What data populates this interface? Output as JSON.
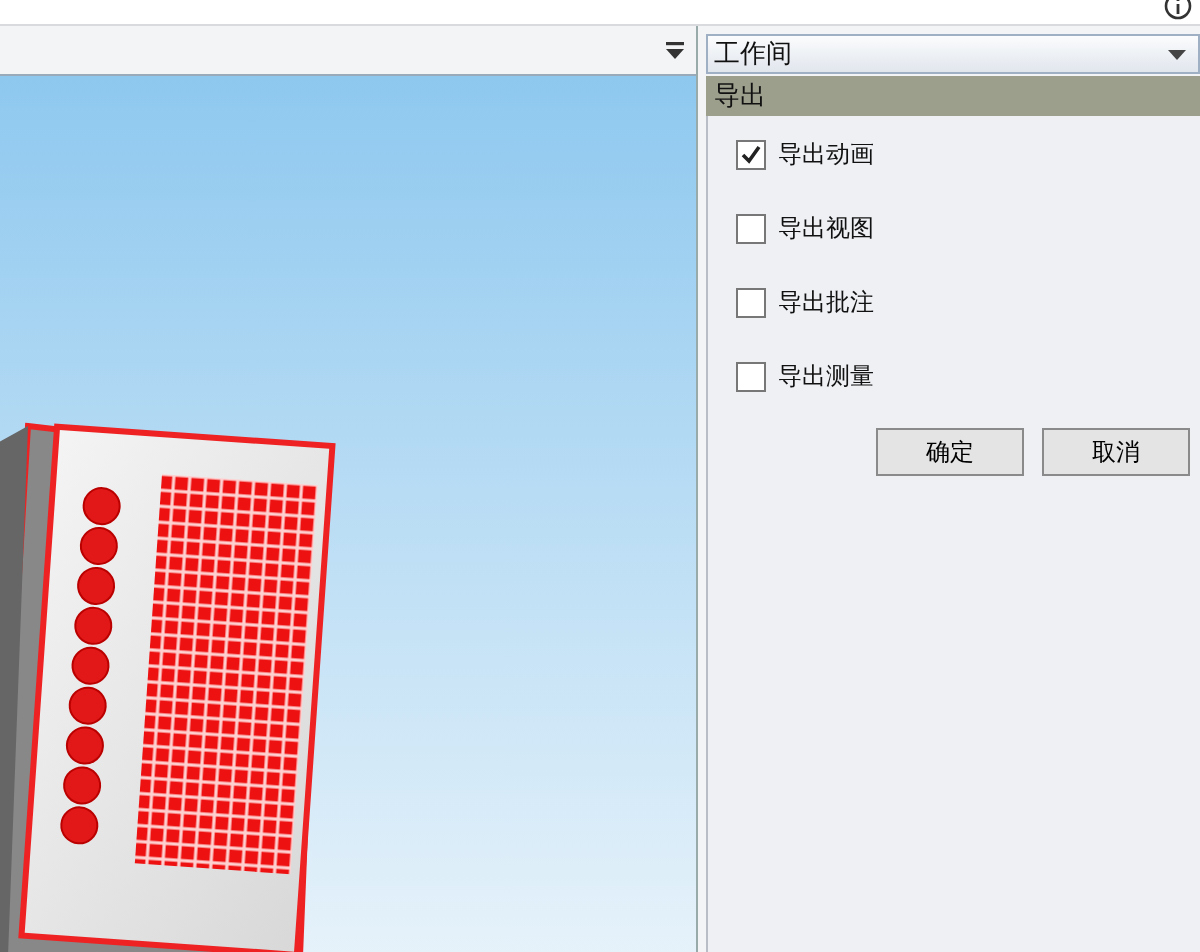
{
  "workspace": {
    "value": "工作间"
  },
  "panel": {
    "title": "导出",
    "options": [
      {
        "label": "导出动画",
        "checked": true
      },
      {
        "label": "导出视图",
        "checked": false
      },
      {
        "label": "导出批注",
        "checked": false
      },
      {
        "label": "导出测量",
        "checked": false
      }
    ],
    "buttons": [
      "确定",
      "取消"
    ]
  }
}
